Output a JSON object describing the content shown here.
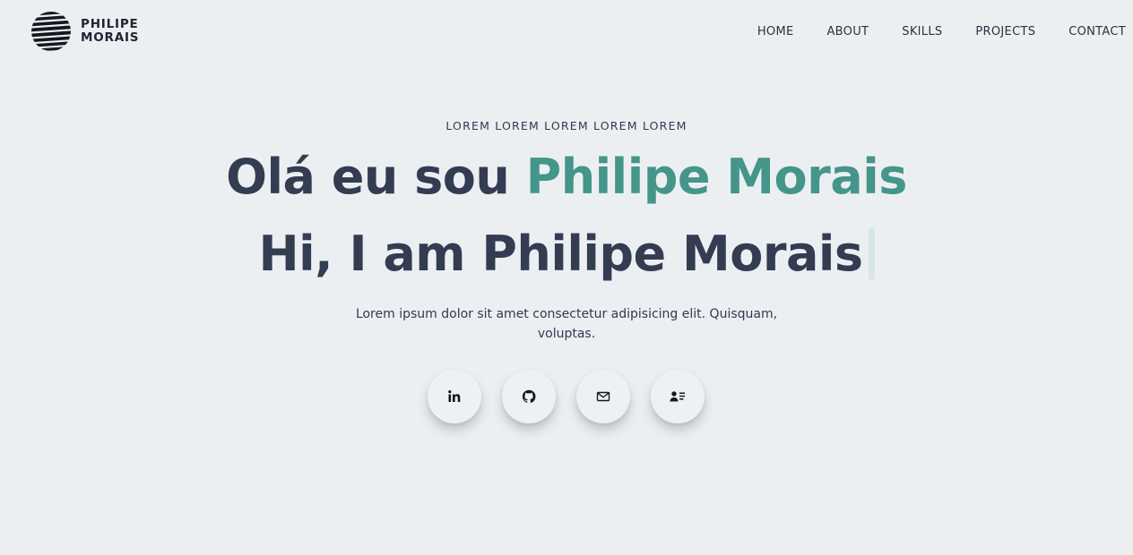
{
  "brand": {
    "name_line1": "PHILIPE",
    "name_line2": "MORAIS"
  },
  "nav": {
    "items": [
      {
        "label": "HOME"
      },
      {
        "label": "ABOUT"
      },
      {
        "label": "SKILLS"
      },
      {
        "label": "PROJECTS"
      },
      {
        "label": "CONTACT"
      }
    ]
  },
  "hero": {
    "eyebrow": "LOREM LOREM LOREM LOREM LOREM",
    "headline_prefix": "Olá eu sou ",
    "headline_accent": "Philipe Morais",
    "typed_text": "Hi, I am Philipe Morais",
    "description": "Lorem ipsum dolor sit amet consectetur adipisicing elit. Quisquam, voluptas."
  },
  "socials": [
    {
      "icon": "linkedin-icon"
    },
    {
      "icon": "github-icon"
    },
    {
      "icon": "mail-icon"
    },
    {
      "icon": "contact-card-icon"
    }
  ],
  "colors": {
    "background": "#eceff2",
    "text": "#333c51",
    "accent": "#44958a"
  }
}
